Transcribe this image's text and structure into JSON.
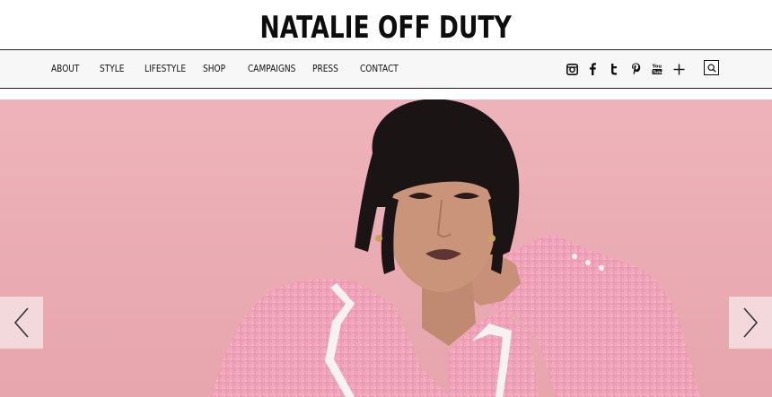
{
  "header": {
    "title": "NATALIE OFF DUTY"
  },
  "nav": {
    "items": [
      {
        "label": "ABOUT"
      },
      {
        "label": "STYLE"
      },
      {
        "label": "LIFESTYLE"
      },
      {
        "label": "SHOP"
      },
      {
        "label": "CAMPAIGNS"
      },
      {
        "label": "PRESS"
      },
      {
        "label": "CONTACT"
      }
    ],
    "social_icons": [
      "instagram-icon",
      "facebook-icon",
      "tumblr-icon",
      "pinterest-icon",
      "youtube-icon",
      "bloglovin-plus-icon"
    ],
    "search_icon": "search-icon"
  },
  "hero": {
    "background": "#eaa9b1",
    "jacket_color": "#f0a6bb",
    "prev_icon": "chevron-left-icon",
    "next_icon": "chevron-right-icon"
  }
}
